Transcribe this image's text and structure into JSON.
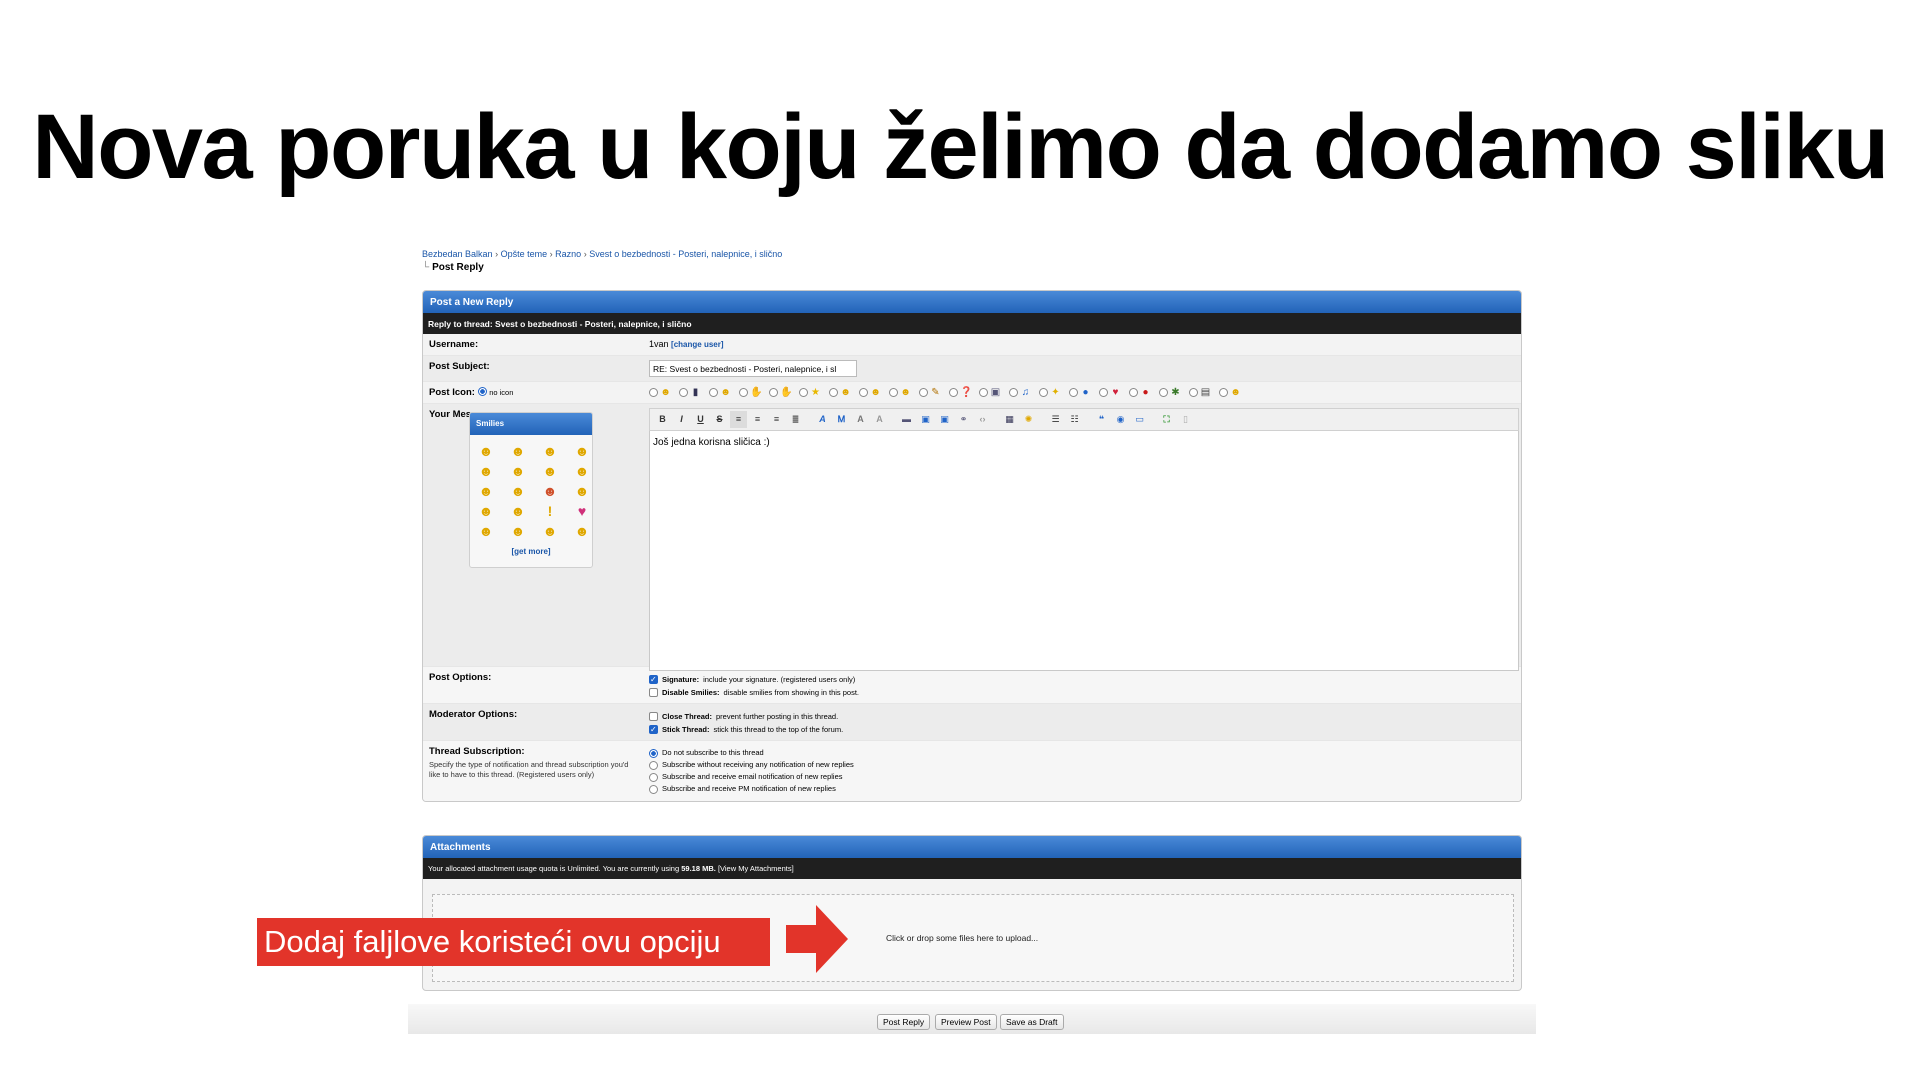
{
  "slide": {
    "title": "Nova poruka u koju želimo da dodamo sliku",
    "callout": "Dodaj faljlove koristeći ovu opciju"
  },
  "breadcrumb": {
    "items": [
      "Bezbedan Balkan",
      "Opšte teme",
      "Razno",
      "Svest o bezbednosti - Posteri, nalepnice, i slično"
    ],
    "current": "Post Reply"
  },
  "reply_form": {
    "header": "Post a New Reply",
    "subheader": "Reply to thread: Svest o bezbednosti - Posteri, nalepnice, i slično",
    "username_label": "Username:",
    "username_value": "1van",
    "change_user": "[change user]",
    "subject_label": "Post Subject:",
    "subject_value": "RE: Svest o bezbednosti - Posteri, nalepnice, i sl",
    "icon_label": "Post Icon:",
    "no_icon": "no icon",
    "message_label": "Your Message:",
    "message_text": "Još jedna korisna sličica :)",
    "smilies_header": "Smilies",
    "get_more": "[get more]",
    "post_options_label": "Post Options:",
    "signature_title": "Signature:",
    "signature_desc": "include your signature. (registered users only)",
    "disable_smilies_title": "Disable Smilies:",
    "disable_smilies_desc": "disable smilies from showing in this post.",
    "moderator_label": "Moderator Options:",
    "close_thread_title": "Close Thread:",
    "close_thread_desc": "prevent further posting in this thread.",
    "stick_thread_title": "Stick Thread:",
    "stick_thread_desc": "stick this thread to the top of the forum.",
    "subscription_label": "Thread Subscription:",
    "subscription_desc": "Specify the type of notification and thread subscription you'd like to have to this thread. (Registered users only)",
    "subscription_options": [
      "Do not subscribe to this thread",
      "Subscribe without receiving any notification of new replies",
      "Subscribe and receive email notification of new replies",
      "Subscribe and receive PM notification of new replies"
    ]
  },
  "attachments": {
    "header": "Attachments",
    "quota_text_pre": "Your allocated attachment usage quota is Unlimited. You are currently using",
    "quota_value": "59.18 MB.",
    "view_link": "[View My Attachments]",
    "dropzone_text": "Click or drop some files here to upload..."
  },
  "buttons": {
    "post_reply": "Post Reply",
    "preview_post": "Preview Post",
    "save_draft": "Save as Draft"
  },
  "colors": {
    "panel_header": "#2263b8",
    "subheader": "#1f1f1f",
    "callout": "#e2342a",
    "link": "#1a56a8"
  }
}
